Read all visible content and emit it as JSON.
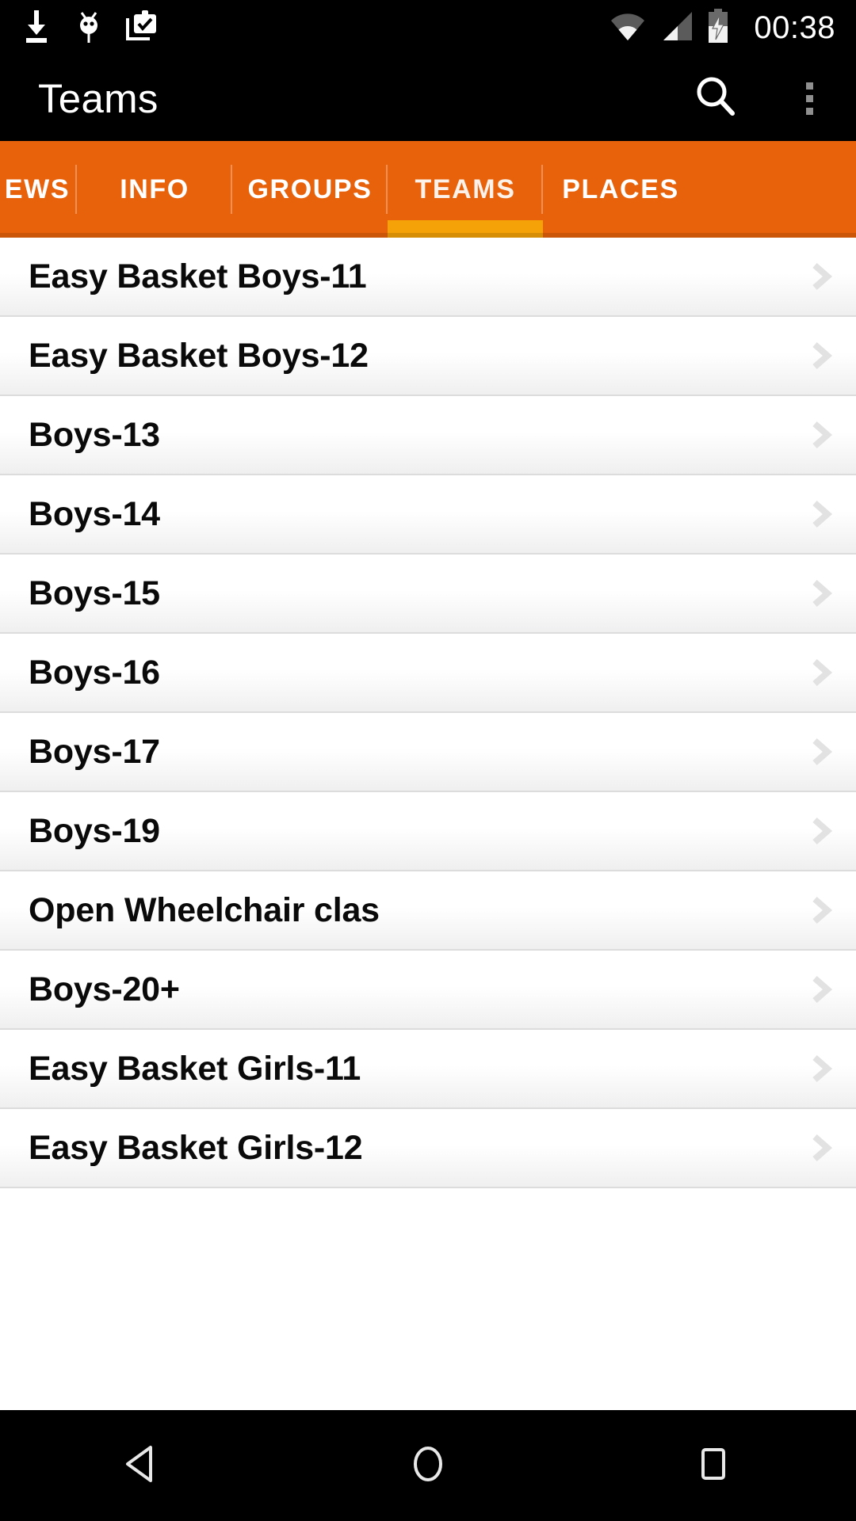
{
  "status_bar": {
    "time": "00:38",
    "icons_left": [
      "download-icon",
      "android-debug-icon",
      "clipboard-check-icon"
    ],
    "icons_right": [
      "wifi-icon",
      "cellular-signal-icon",
      "battery-charging-icon"
    ]
  },
  "action_bar": {
    "title": "Teams",
    "search_icon": "search-icon",
    "overflow_icon": "overflow-menu-icon"
  },
  "tabs": {
    "items": [
      {
        "label": "EWS",
        "active": false
      },
      {
        "label": "INFO",
        "active": false
      },
      {
        "label": "GROUPS",
        "active": false
      },
      {
        "label": "TEAMS",
        "active": true
      },
      {
        "label": "PLACES",
        "active": false
      }
    ],
    "active_index": 3,
    "bar_color": "#e8620c",
    "indicator_color": "#f5a208"
  },
  "list": {
    "items": [
      {
        "label": "Easy Basket Boys-11"
      },
      {
        "label": "Easy Basket Boys-12"
      },
      {
        "label": "Boys-13"
      },
      {
        "label": "Boys-14"
      },
      {
        "label": "Boys-15"
      },
      {
        "label": "Boys-16"
      },
      {
        "label": "Boys-17"
      },
      {
        "label": "Boys-19"
      },
      {
        "label": "Open Wheelchair clas"
      },
      {
        "label": "Boys-20+"
      },
      {
        "label": "Easy Basket Girls-11"
      },
      {
        "label": "Easy Basket Girls-12"
      }
    ],
    "chevron_icon": "chevron-right-icon"
  },
  "nav_bar": {
    "back": "back-icon",
    "home": "home-icon",
    "recents": "recents-icon"
  }
}
